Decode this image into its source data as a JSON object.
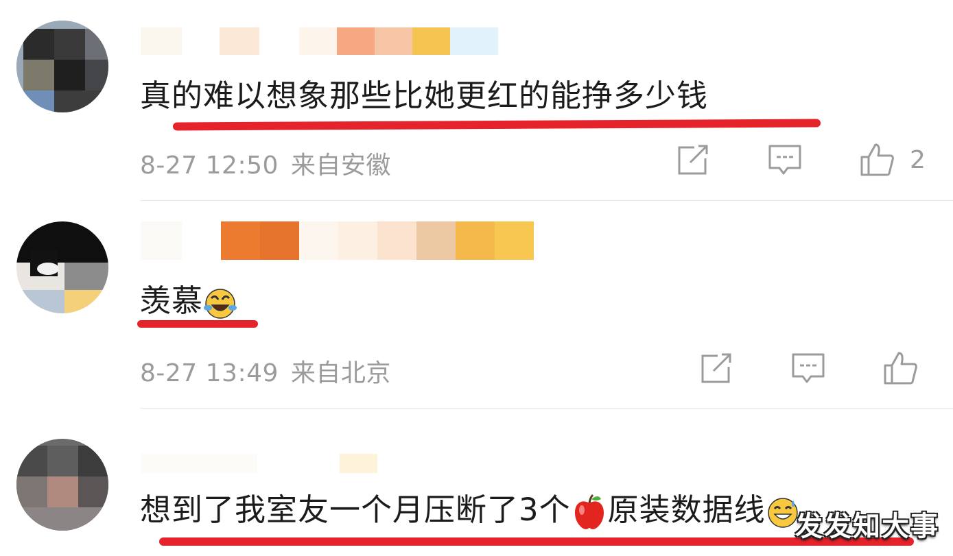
{
  "comments": [
    {
      "text": "真的难以想象那些比她更红的能挣多少钱",
      "date": "8-27 12:50",
      "location": "来自安徽",
      "like_count": "2",
      "icons": [
        "share-icon",
        "comment-icon",
        "thumbs-up-icon"
      ]
    },
    {
      "text": "羡慕",
      "emoji": "laughing-crying-emoji",
      "date": "8-27 13:49",
      "location": "来自北京",
      "icons": [
        "share-icon",
        "comment-icon",
        "thumbs-up-icon"
      ]
    },
    {
      "text_before": "想到了我室友一个月压断了3个",
      "emoji_apple": "red-apple-emoji",
      "text_after": "原装数据线",
      "emoji": "grinning-sweat-emoji"
    }
  ],
  "watermark": "发发知大事",
  "colors": {
    "underline": "#e5232b",
    "meta_gray": "#9b9b9b"
  }
}
